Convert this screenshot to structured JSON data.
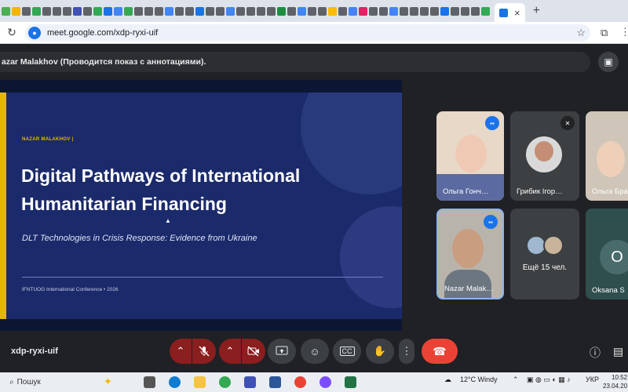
{
  "browser": {
    "tab_close": "×",
    "new_tab": "+",
    "url": "meet.google.com/xdp-ryxi-uif",
    "reload": "↻",
    "star": "☆",
    "extensions": "⧉",
    "menu": "⋮"
  },
  "meet": {
    "presenter_notice": "azar Malakhov (Проводится показ с аннотациями).",
    "meeting_code": "xdp-ryxi-uif",
    "participants": [
      {
        "name": "Ольга Гонч…",
        "state": "speaking"
      },
      {
        "name": "Грибик Ігор…",
        "state": "muted"
      },
      {
        "name": "Ольга Бра",
        "state": ""
      },
      {
        "name": "Nazar Malak…",
        "state": "speaking"
      },
      {
        "name": "Ещё 15 чел.",
        "state": ""
      },
      {
        "name": "Oksana S",
        "initial": "O"
      }
    ]
  },
  "slide": {
    "author": "NAZAR MALAKHOV  |",
    "title_line1": "Digital Pathways of International",
    "title_line2": "Humanitarian Financing",
    "subtitle": "DLT Technologies in Crisis Response: Evidence from Ukraine",
    "footer": "IFNTUOG International Conference  •  2026"
  },
  "taskbar": {
    "search_label": "Пошук",
    "weather": "12°C  Windy",
    "lang": "УКР",
    "time": "10:52",
    "date": "23.04.20"
  },
  "colors": {
    "accent_yellow": "#e5b700",
    "slide_bg": "#1b2a6b",
    "hangup": "#ea4335",
    "speaking": "#1a73e8"
  }
}
